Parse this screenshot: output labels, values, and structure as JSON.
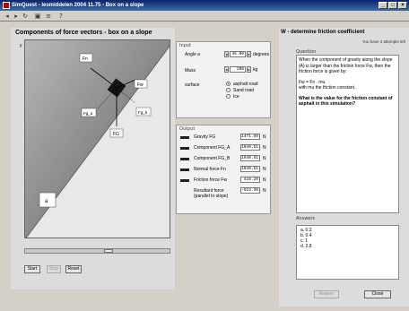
{
  "window": {
    "title": "SimQuest - lesmiddelen 2004 11.75 - Box on a slope"
  },
  "toolbar": {
    "icons": [
      "back-icon",
      "forward-icon",
      "refresh-icon",
      "save-icon",
      "help-icon"
    ]
  },
  "left": {
    "title": "Components of force vectors - box on a slope",
    "axis_y": "y",
    "forces": {
      "fn": "Fn",
      "fw": "Fw",
      "fg": "FG",
      "fg_a": "Fg_a",
      "fg_b": "Fg_b"
    },
    "angle_label": "a",
    "buttons": {
      "start": "Start",
      "stop": "Stop",
      "reset": "Reset"
    }
  },
  "input": {
    "title": "Input",
    "angle": {
      "label": "Angle a",
      "value": "45.00",
      "unit": "degrees"
    },
    "mass": {
      "label": "Mass",
      "value": "200",
      "unit": "kg"
    },
    "surface": {
      "label": "surface",
      "options": [
        "asphalt road",
        "Sand road",
        "Ice"
      ],
      "selected": 0
    }
  },
  "output": {
    "title": "Output",
    "rows": [
      {
        "label": "Gravity FG",
        "value": "1471.50",
        "unit": "N"
      },
      {
        "label": "Component FG_A",
        "value": "1040.51",
        "unit": "N"
      },
      {
        "label": "Component FG_B",
        "value": "1040.51",
        "unit": "N"
      },
      {
        "label": "Normal force Fn",
        "value": "1040.51",
        "unit": "N"
      },
      {
        "label": "Friction force Fw",
        "value": "416.20",
        "unit": "N"
      },
      {
        "label": "Resultant force (parallel to slope)",
        "value": "-624.30",
        "unit": "N"
      }
    ]
  },
  "right": {
    "title": "W - determine friction coefficient",
    "task": "You have 3 attempts left",
    "question_label": "Question",
    "question_p1": "When the component of gravity along the slope (A) is larger than the friction force Fw, then the friction force is given by:",
    "question_formula": "Fw = Fn . mu",
    "question_p2": "with mu the friction constant.",
    "question_bold": "What is the value for the friction constant of asphalt in this simulation?",
    "answers_label": "Answers",
    "answers": [
      "a. 0.2",
      "b. 0.4",
      "c. 1",
      "d. 2.8"
    ],
    "buttons": {
      "answer": "Answer",
      "close": "Close"
    }
  }
}
